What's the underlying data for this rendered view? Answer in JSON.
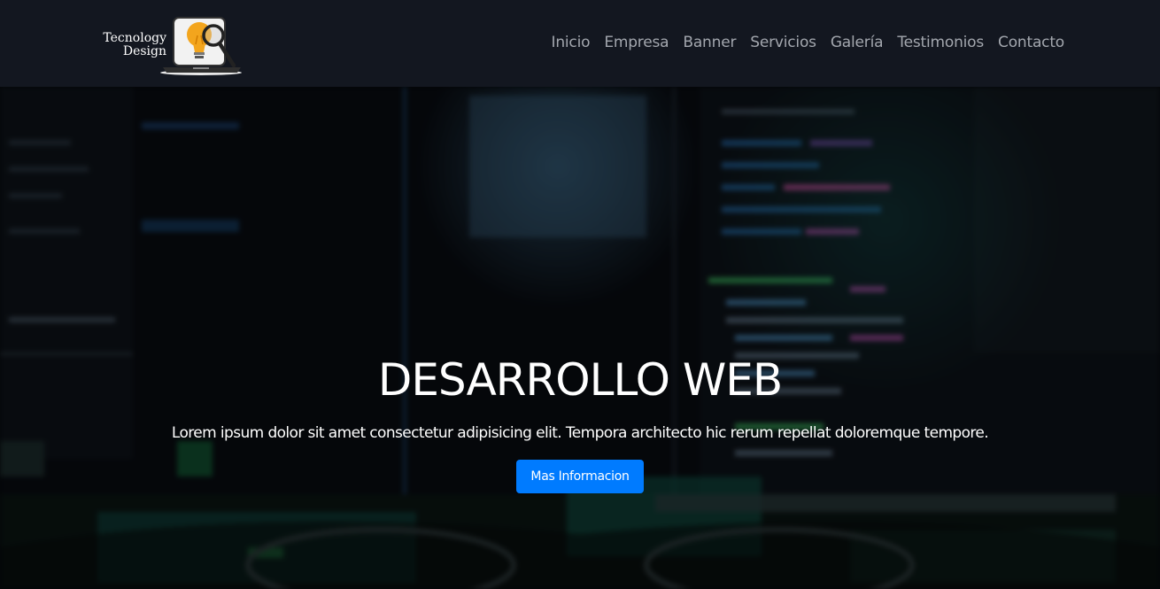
{
  "brand": {
    "line1": "Tecnology",
    "line2": "Design",
    "logo_icon": "laptop-lightbulb-magnifier-icon"
  },
  "nav": {
    "items": [
      {
        "label": "Inicio"
      },
      {
        "label": "Empresa"
      },
      {
        "label": "Banner"
      },
      {
        "label": "Servicios"
      },
      {
        "label": "Galería"
      },
      {
        "label": "Testimonios"
      },
      {
        "label": "Contacto"
      }
    ]
  },
  "hero": {
    "title": "DESARROLLO WEB",
    "text": "Lorem ipsum dolor sit amet consectetur adipisicing elit. Tempora architecto hic rerum repellat doloremque tempore.",
    "button_label": "Mas Informacion",
    "background": "blurred-code-screen-photo"
  },
  "colors": {
    "navbar_bg": "#131720",
    "nav_link": "#a3a7ae",
    "button_bg": "#007bff",
    "hero_bg": "#070a0e"
  }
}
